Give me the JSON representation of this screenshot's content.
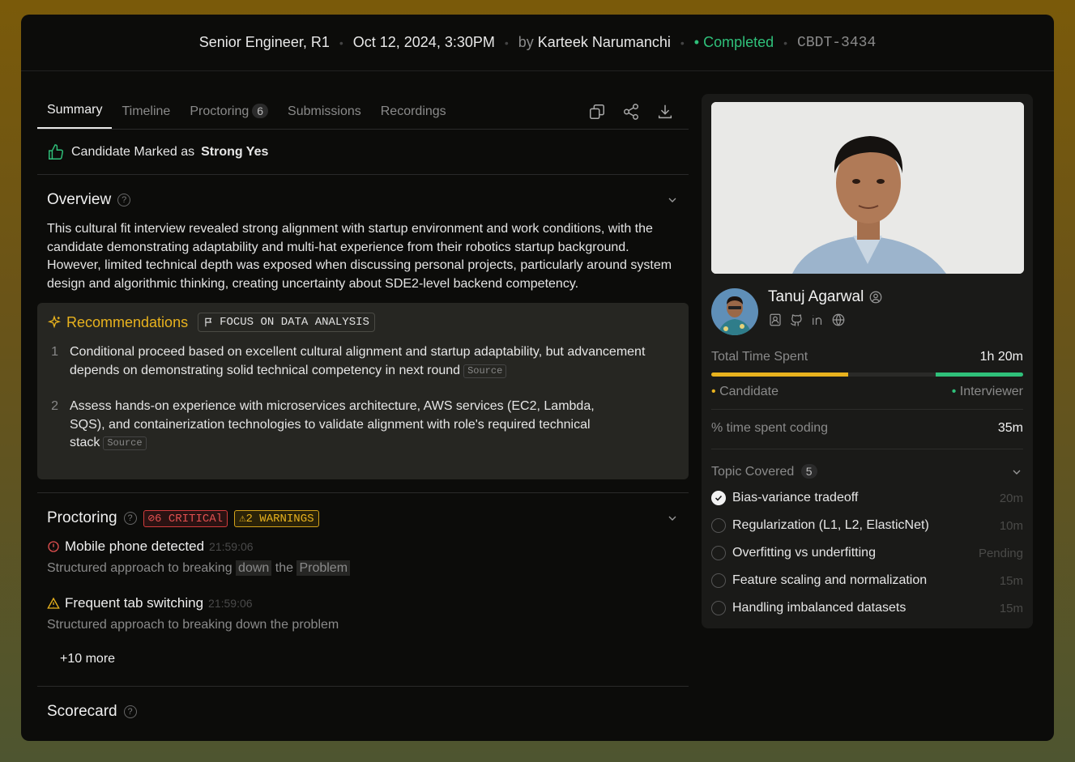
{
  "header": {
    "role": "Senior Engineer, R1",
    "datetime": "Oct 12, 2024, 3:30PM",
    "by_label": "by",
    "interviewer": "Karteek Narumanchi",
    "status": "Completed",
    "ticket": "CBDT-3434"
  },
  "tabs": [
    {
      "label": "Summary",
      "active": true
    },
    {
      "label": "Timeline"
    },
    {
      "label": "Proctoring",
      "badge": "6"
    },
    {
      "label": "Submissions"
    },
    {
      "label": "Recordings"
    }
  ],
  "verdict": {
    "prefix": "Candidate Marked as",
    "value": "Strong Yes"
  },
  "overview": {
    "title": "Overview",
    "text": "This cultural fit interview revealed strong alignment with startup environment and work conditions, with the candidate demonstrating adaptability and multi-hat experience from their robotics startup background. However, limited technical depth was exposed when discussing personal projects, particularly around system design and algorithmic thinking, creating uncertainty about SDE2-level backend competency."
  },
  "recommendations": {
    "title": "Recommendations",
    "focus": "FOCUS ON DATA ANALYSIS",
    "source_label": "Source",
    "items": [
      {
        "num": "1",
        "text": "Conditional proceed based on excellent cultural alignment and startup adaptability, but advancement depends on demonstrating solid technical competency in next round"
      },
      {
        "num": "2",
        "text": "Assess hands-on experience with microservices architecture, AWS services (EC2, Lambda, SQS), and containerization technologies to validate alignment with role's required technical stack"
      }
    ]
  },
  "proctoring": {
    "title": "Proctoring",
    "critical": "6 CRITICAl",
    "warnings": "2 WARNINGS",
    "events": [
      {
        "title": "Mobile phone detected",
        "time": "21:59:06",
        "desc_a": "Structured approach to breaking",
        "desc_hl1": "down",
        "desc_b": "the",
        "desc_hl2": "Problem"
      },
      {
        "title": "Frequent tab switching",
        "time": "21:59:06",
        "desc": "Structured approach to breaking down the problem"
      }
    ],
    "more": "+10 more"
  },
  "scorecard": {
    "title": "Scorecard"
  },
  "candidate": {
    "name": "Tanuj Agarwal",
    "time_label": "Total Time Spent",
    "time_value": "1h 20m",
    "candidate_label": "Candidate",
    "interviewer_label": "Interviewer",
    "candidate_share": 0.44,
    "interviewer_share": 0.28,
    "coding_label": "% time spent coding",
    "coding_value": "35m",
    "topics_label": "Topic Covered",
    "topics_count": "5",
    "topics": [
      {
        "name": "Bias-variance tradeoff",
        "time": "20m",
        "done": true
      },
      {
        "name": "Regularization (L1, L2, ElasticNet)",
        "time": "10m",
        "done": false
      },
      {
        "name": "Overfitting vs underfitting",
        "time": "Pending",
        "done": false
      },
      {
        "name": "Feature scaling and normalization",
        "time": "15m",
        "done": false
      },
      {
        "name": "Handling imbalanced datasets",
        "time": "15m",
        "done": false
      }
    ]
  },
  "colors": {
    "accent_yellow": "#e8b21e",
    "accent_green": "#2fc07a",
    "critical": "#e25050"
  }
}
